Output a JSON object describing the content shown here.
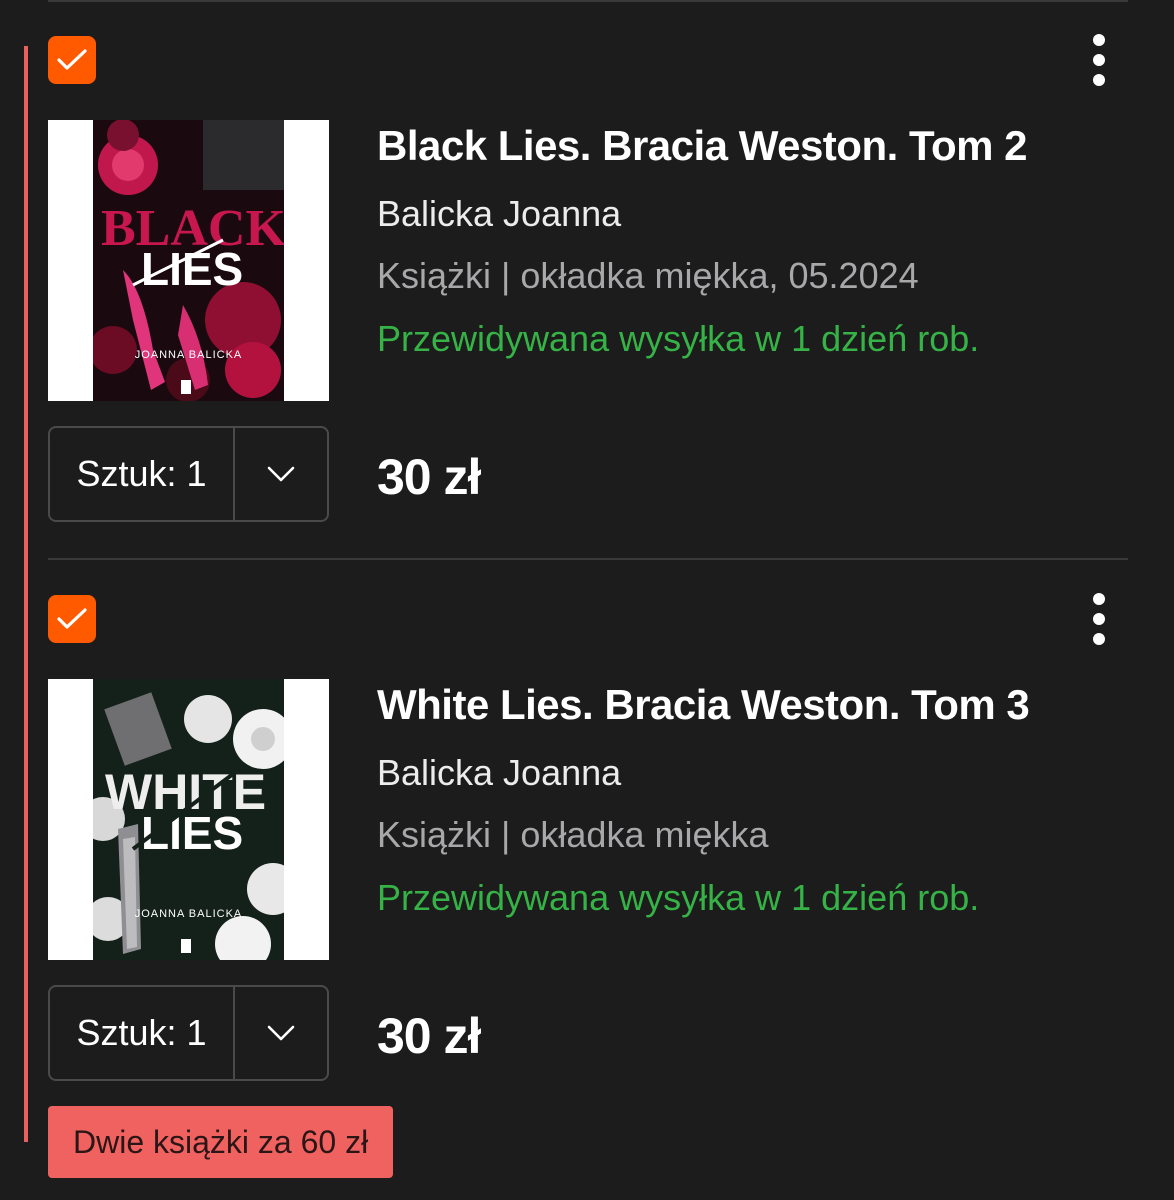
{
  "cart_items": [
    {
      "selected": true,
      "title": "Black Lies. Bracia Weston. Tom 2",
      "author": "Balicka Joanna",
      "format": "Książki | okładka miękka, 05.2024",
      "shipping": "Przewidywana wysyłka w 1 dzień rob.",
      "quantity_label": "Sztuk: 1",
      "price": "30 zł",
      "cover": {
        "big_word_1": "BLACK",
        "big_word_2": "LIES",
        "author_on_cover": "JOANNA BALICKA",
        "accent": "#c8164e",
        "bg": "#1a0a10"
      }
    },
    {
      "selected": true,
      "title": "White Lies. Bracia Weston. Tom 3",
      "author": "Balicka Joanna",
      "format": "Książki | okładka miękka",
      "shipping": "Przewidywana wysyłka w 1 dzień rob.",
      "quantity_label": "Sztuk: 1",
      "price": "30 zł",
      "cover": {
        "big_word_1": "WHITE",
        "big_word_2": "LIES",
        "author_on_cover": "JOANNA BALICKA",
        "accent": "#e9e9e9",
        "bg": "#14211a"
      }
    }
  ],
  "promo_badge": "Dwie książki za 60 zł",
  "colors": {
    "background": "#1c1c1d",
    "checkbox": "#ff5a00",
    "shipping_green": "#36b346",
    "promo": "#f0625f"
  },
  "icons": [
    "checkmark-icon",
    "more-vertical-icon",
    "chevron-down-icon"
  ]
}
